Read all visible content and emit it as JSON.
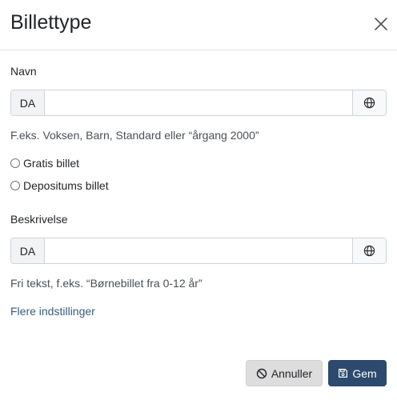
{
  "modal": {
    "title": "Billettype",
    "close_icon": "close-icon"
  },
  "name_field": {
    "label": "Navn",
    "lang": "DA",
    "value": "",
    "help": "F.eks. Voksen, Barn, Standard eller “årgang 2000”",
    "translate_icon": "globe-icon"
  },
  "options": {
    "free_ticket": "Gratis billet",
    "deposit_ticket": "Depositums billet"
  },
  "description_field": {
    "label": "Beskrivelse",
    "lang": "DA",
    "value": "",
    "help": "Fri tekst, f.eks. “Børnebillet fra 0-12 år”",
    "translate_icon": "globe-icon"
  },
  "more_settings": "Flere indstillinger",
  "footer": {
    "cancel_label": "Annuller",
    "cancel_icon": "ban-icon",
    "save_label": "Gem",
    "save_icon": "floppy-disk-icon"
  },
  "colors": {
    "primary": "#2c4a6e",
    "link": "#3b5a78",
    "cancel_bg": "#dddddd"
  }
}
